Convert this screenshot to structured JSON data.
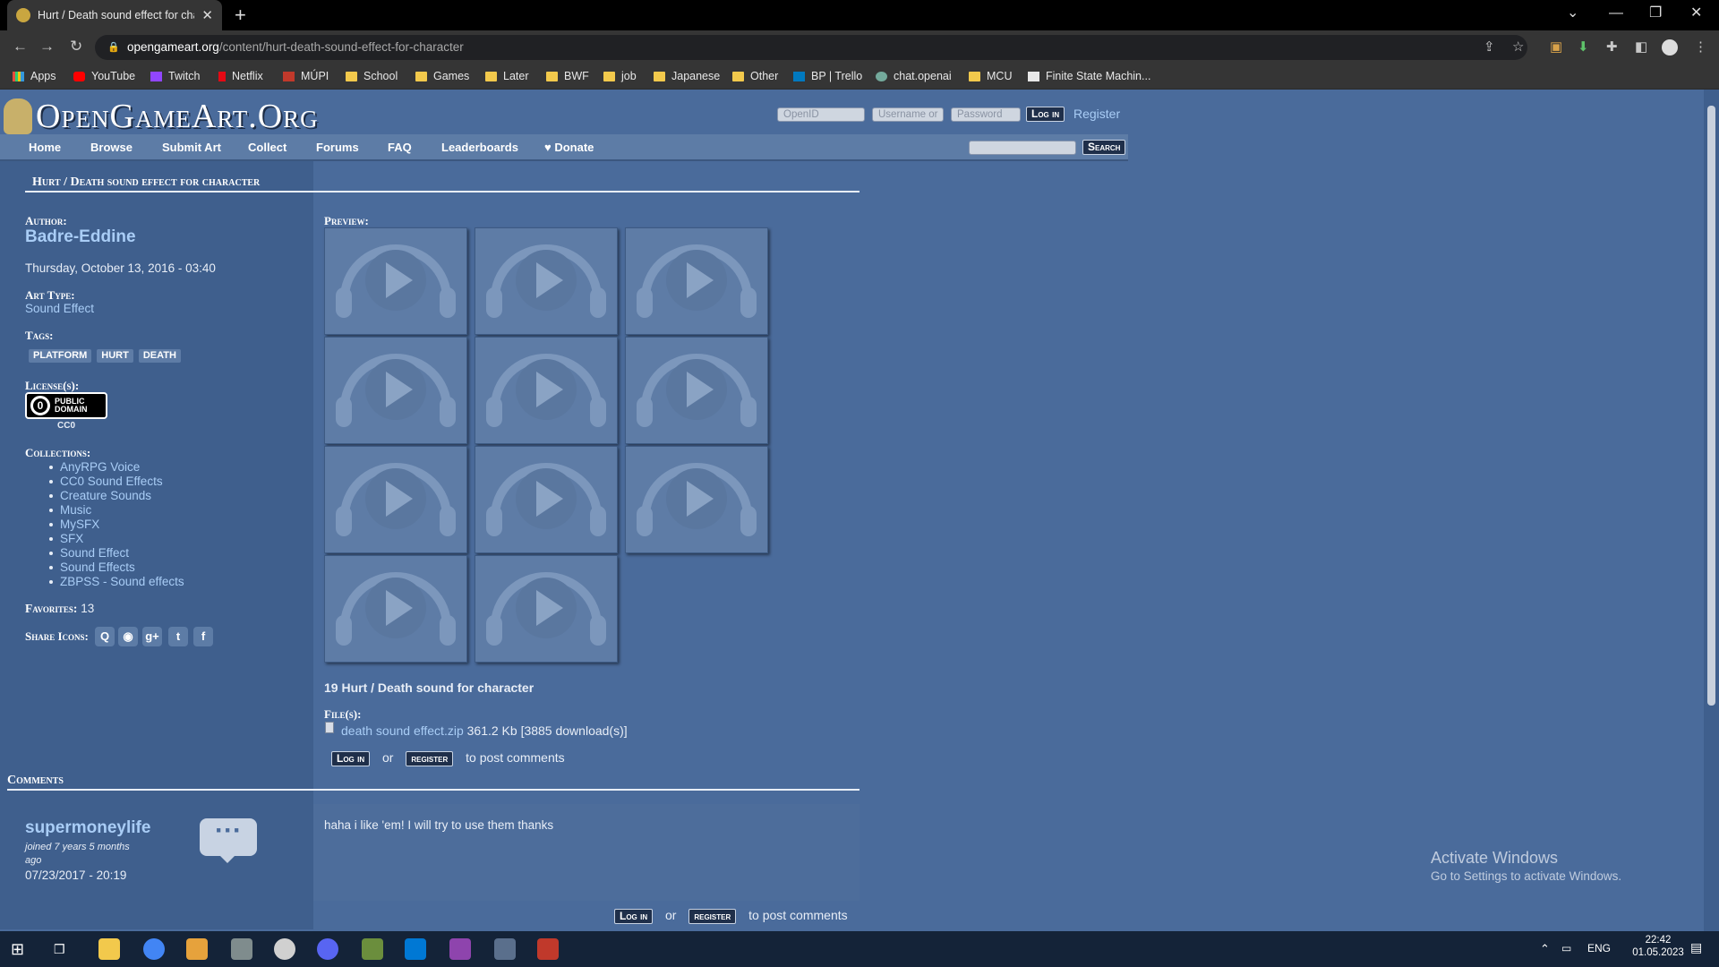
{
  "browser": {
    "tab_title": "Hurt / Death sound effect for cha",
    "url_host": "opengameart.org",
    "url_path": "/content/hurt-death-sound-effect-for-character",
    "bookmarks": [
      "Apps",
      "YouTube",
      "Twitch",
      "Netflix",
      "MÚPI",
      "School",
      "Games",
      "Later",
      "BWF",
      "job",
      "Japanese",
      "Other",
      "BP | Trello",
      "chat.openai",
      "MCU",
      "Finite State Machin..."
    ]
  },
  "site": {
    "logo": "OpenGameArt.Org",
    "openid_placeholder": "OpenID",
    "username_placeholder": "Username or",
    "password_placeholder": "Password",
    "login_label": "Log in",
    "register_label": "Register",
    "search_label": "Search",
    "nav": [
      "Home",
      "Browse",
      "Submit Art",
      "Collect",
      "Forums",
      "FAQ",
      "Leaderboards",
      "Donate"
    ],
    "donate_icon": "heart-icon"
  },
  "page": {
    "title": "Hurt / Death sound effect for character",
    "author_label": "Author:",
    "author": "Badre-Eddine",
    "date": "Thursday, October 13, 2016 - 03:40",
    "art_type_label": "Art Type:",
    "art_type": "Sound Effect",
    "tags_label": "Tags:",
    "tags": [
      "PLATFORM",
      "HURT",
      "DEATH"
    ],
    "license_label": "License(s):",
    "license_badge_text": "PUBLIC DOMAIN",
    "license_symbol": "0",
    "license": "CC0",
    "collections_label": "Collections:",
    "collections": [
      "AnyRPG Voice",
      "CC0 Sound Effects",
      "Creature Sounds",
      "Music",
      "MySFX",
      "SFX",
      "Sound Effect",
      "Sound Effects",
      "ZBPSS - Sound effects"
    ],
    "favorites_label": "Favorites:",
    "favorites": "13",
    "share_label": "Share Icons:",
    "share_glyphs": [
      "Q",
      "◉",
      "g+",
      "t",
      "f"
    ],
    "share_icons": [
      "reddit-icon",
      "stumbleupon-icon",
      "google-plus-icon",
      "twitter-icon",
      "facebook-icon"
    ],
    "preview_label": "Preview:",
    "preview_count": 11,
    "description": "19 Hurt / Death  sound for character",
    "files_label": "File(s):",
    "file_name": "death sound effect.zip",
    "file_meta": "361.2 Kb [3885 download(s)]",
    "login_btn": "Log in",
    "or": "or",
    "register_btn": "register",
    "to_post": "to post comments"
  },
  "comments": {
    "heading": "Comments",
    "user": "supermoneylife",
    "joined_line1": "joined 7 years 5 months",
    "joined_line2": "ago",
    "timestamp": "07/23/2017 - 20:19",
    "body": "haha i like 'em! I will try to use them thanks",
    "bubble": "···"
  },
  "watermark": {
    "title": "Activate Windows",
    "subtitle": "Go to Settings to activate Windows."
  },
  "system": {
    "lang": "ENG",
    "time": "22:42",
    "date": "01.05.2023"
  },
  "colors": {
    "page_bg": "#4a6b9b",
    "sidebar_bg": "#3f5f8d",
    "link": "#a9cdf6"
  }
}
